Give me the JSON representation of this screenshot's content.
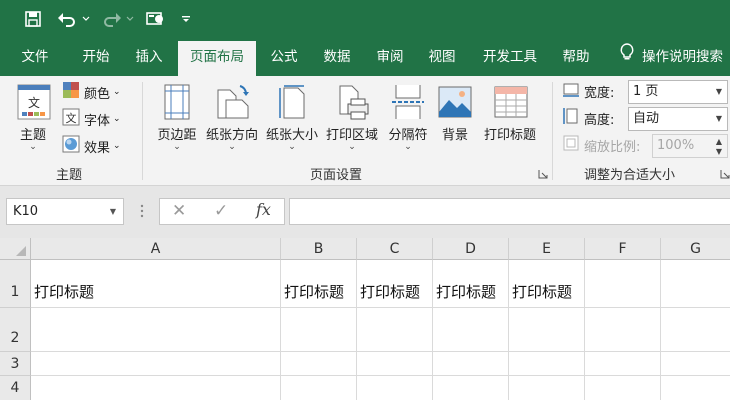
{
  "quick_access": {
    "icons": [
      "save-icon",
      "undo-icon",
      "redo-icon",
      "touch-mode-icon",
      "customize-icon"
    ]
  },
  "tabs": [
    "文件",
    "开始",
    "插入",
    "页面布局",
    "公式",
    "数据",
    "审阅",
    "视图",
    "开发工具",
    "帮助"
  ],
  "active_tab": "页面布局",
  "tell_me": "操作说明搜索",
  "ribbon": {
    "themes_group": {
      "theme_label": "主题",
      "colors_label": "颜色",
      "fonts_label": "字体",
      "effects_label": "效果",
      "group_label": "主题"
    },
    "page_setup_group": {
      "margins_label": "页边距",
      "orientation_label": "纸张方向",
      "size_label": "纸张大小",
      "print_area_label": "打印区域",
      "breaks_label": "分隔符",
      "background_label": "背景",
      "print_titles_label": "打印标题",
      "group_label": "页面设置"
    },
    "scale_group": {
      "width_label": "宽度:",
      "width_value": "1 页",
      "height_label": "高度:",
      "height_value": "自动",
      "scale_label": "缩放比例:",
      "scale_value": "100%",
      "group_label": "调整为合适大小"
    }
  },
  "formula_bar": {
    "name_box": "K10",
    "cancel_icon": "✕",
    "enter_icon": "✓",
    "fx_label": "fx",
    "formula": ""
  },
  "grid": {
    "columns": [
      "A",
      "B",
      "C",
      "D",
      "E",
      "F",
      "G"
    ],
    "rows": [
      "1",
      "2",
      "3",
      "4"
    ],
    "cells": {
      "A1": "打印标题",
      "B1": "打印标题",
      "C1": "打印标题",
      "D1": "打印标题",
      "E1": "打印标题"
    }
  },
  "colors": {
    "excel_green": "#217346",
    "ribbon_bg": "#f3f3f3"
  }
}
